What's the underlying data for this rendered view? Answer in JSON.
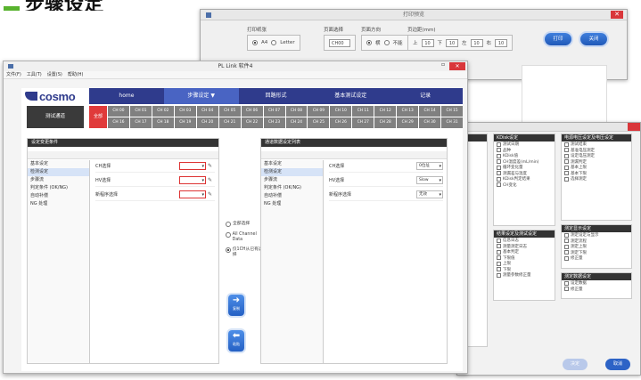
{
  "heading": {
    "text": "步骤设定"
  },
  "print_dialog": {
    "title": "打印预览",
    "size_group": {
      "label": "打印纸张",
      "a4": "A4",
      "letter": "Letter"
    },
    "scale_group": {
      "label": "页面选择",
      "value": "CH00"
    },
    "orientation_group": {
      "label": "页面方向",
      "portrait": "横",
      "landscape": "不能"
    },
    "margins_group": {
      "label": "页边距(mm)",
      "top_label": "上",
      "top": "10",
      "bottom_label": "下",
      "bottom": "10",
      "left_label": "左",
      "left": "10",
      "right_label": "右",
      "right": "10"
    },
    "print_button": "打印",
    "close_button": "关闭"
  },
  "main": {
    "title": "PL Link 软件4",
    "menu": [
      "文件(F)",
      "工具(T)",
      "设置(S)",
      "帮助(H)"
    ],
    "logo": "cosmo",
    "nav_tabs": [
      {
        "label": "home",
        "active": false
      },
      {
        "label": "步骤设定 ▼",
        "active": true
      },
      {
        "label": "回路形式",
        "active": false
      },
      {
        "label": "基本测试设定",
        "active": false
      },
      {
        "label": "记录",
        "active": false
      }
    ],
    "channel_label": "测试通道",
    "all_label": "全部",
    "channels": [
      "CH 00",
      "CH 01",
      "CH 02",
      "CH 03",
      "CH 04",
      "CH 05",
      "CH 06",
      "CH 07",
      "CH 08",
      "CH 09",
      "CH 10",
      "CH 11",
      "CH 12",
      "CH 13",
      "CH 14",
      "CH 15",
      "CH 16",
      "CH 17",
      "CH 18",
      "CH 19",
      "CH 20",
      "CH 21",
      "CH 22",
      "CH 23",
      "CH 24",
      "CH 25",
      "CH 26",
      "CH 27",
      "CH 28",
      "CH 29",
      "CH 30",
      "CH 31"
    ],
    "left_panel": {
      "header": "设定变更条件",
      "list": [
        "基本设定",
        "检测设定",
        "步骤流",
        "判定条件 (OK/NG)",
        "自动补偿",
        "NG 处理"
      ],
      "rows": [
        {
          "label": "CH选择",
          "value": ""
        },
        {
          "label": "HV选择",
          "value": ""
        },
        {
          "label": "新程序选择",
          "value": ""
        }
      ]
    },
    "middle": {
      "opt1": "全部选择",
      "opt2": "All Channel Data",
      "opt3": "仅1CH从已有选择",
      "copy_button": "复制",
      "paste_button": "粘贴"
    },
    "right_panel": {
      "header": "通道数据设定列表",
      "list": [
        "基本设定",
        "检测设定",
        "步骤流",
        "判定条件 (OK/NG)",
        "自动补偿",
        "NG 处理"
      ],
      "rows": [
        {
          "label": "CH选择",
          "value": "0位址"
        },
        {
          "label": "HV选择",
          "value": "Slow"
        },
        {
          "label": "新程序选择",
          "value": "无效"
        }
      ]
    }
  },
  "report_dialog": {
    "group1": {
      "header": "",
      "items": []
    },
    "group2": {
      "header": "KDisk设定",
      "items": [
        "测试日期",
        "品种",
        "KDisk值",
        "CH温度差(mL/min)",
        "循环变化量",
        "测漏差与温度",
        "KDisk判定结果",
        "CH变化"
      ]
    },
    "group3": {
      "header": "电源电压设定及电压设定",
      "items": [
        "测试结束",
        "基准电压测定",
        "设定电压测定",
        "测漏判定",
        "基本上限",
        "基本下限",
        "选择测定"
      ]
    },
    "group4": {
      "header": "结果设定及测试设定",
      "items": [
        "信息日志",
        "测量测定日志",
        "基本判定",
        "下限值",
        "上限",
        "下限",
        "测量参数修正量"
      ]
    },
    "group5": {
      "header": "测定显示设定",
      "items": [
        "测定设定与显示",
        "测定流程",
        "测定上限",
        "测定下限",
        "修正量"
      ]
    },
    "group6": {
      "header": "测定数据设定",
      "items": [
        "设定数据",
        "修正量"
      ]
    },
    "ok_button": "决定",
    "cancel_button": "取消"
  }
}
